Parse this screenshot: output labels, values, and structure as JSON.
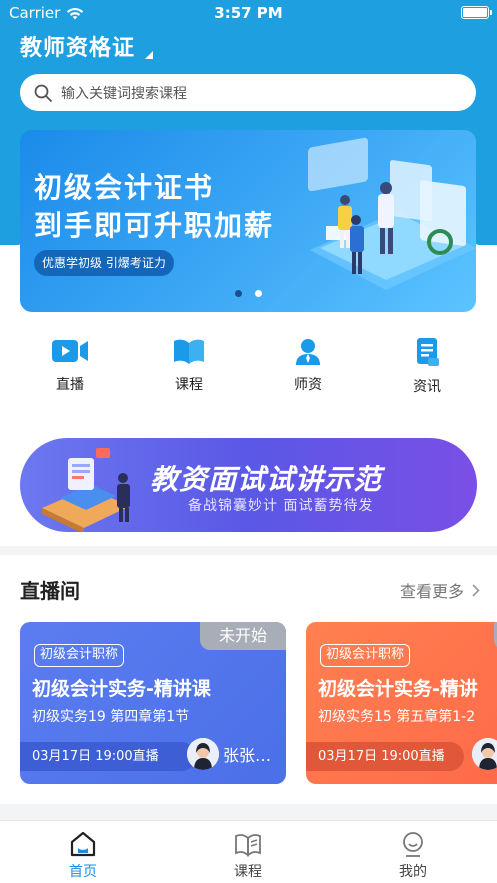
{
  "status_bar": {
    "carrier": "Carrier",
    "time": "3:57 PM"
  },
  "header": {
    "title": "教师资格证"
  },
  "search": {
    "placeholder": "输入关键词搜索课程"
  },
  "banner": {
    "line1": "初级会计证书",
    "line2": "到手即可升职加薪",
    "tag": "优惠学初级 引爆考证力",
    "active_dot": 2,
    "dot_count": 2
  },
  "quick_nav": [
    {
      "label": "直播",
      "icon": "live-video-icon"
    },
    {
      "label": "课程",
      "icon": "book-icon"
    },
    {
      "label": "师资",
      "icon": "teacher-icon"
    },
    {
      "label": "资讯",
      "icon": "news-icon"
    }
  ],
  "promo": {
    "title": "教资面试试讲示范",
    "subtitle": "备战锦囊妙计  面试蓄势待发"
  },
  "live_section": {
    "title": "直播间",
    "more": "查看更多"
  },
  "live_cards": [
    {
      "badge": "初级会计职称",
      "title": "初级会计实务-精讲课",
      "subtitle": "初级实务19 第四章第1节",
      "time": "03月17日 19:00直播",
      "teacher": "张张…",
      "state": "未开始",
      "color": "#5b7df0"
    },
    {
      "badge": "初级会计职称",
      "title": "初级会计实务-精讲",
      "subtitle": "初级实务15 第五章第1-2",
      "time": "03月17日 19:00直播",
      "teacher": "",
      "state": "",
      "color": "#ff7a4e"
    }
  ],
  "tabbar": [
    {
      "label": "首页",
      "icon": "home-icon",
      "active": true
    },
    {
      "label": "课程",
      "icon": "course-book-icon",
      "active": false
    },
    {
      "label": "我的",
      "icon": "profile-icon",
      "active": false
    }
  ],
  "colors": {
    "primary": "#1e9fe0",
    "tab_active": "#1a8ee0",
    "card_blue": "#5b7df0",
    "card_orange": "#ff7a4e",
    "promo": "#5a58e6"
  }
}
